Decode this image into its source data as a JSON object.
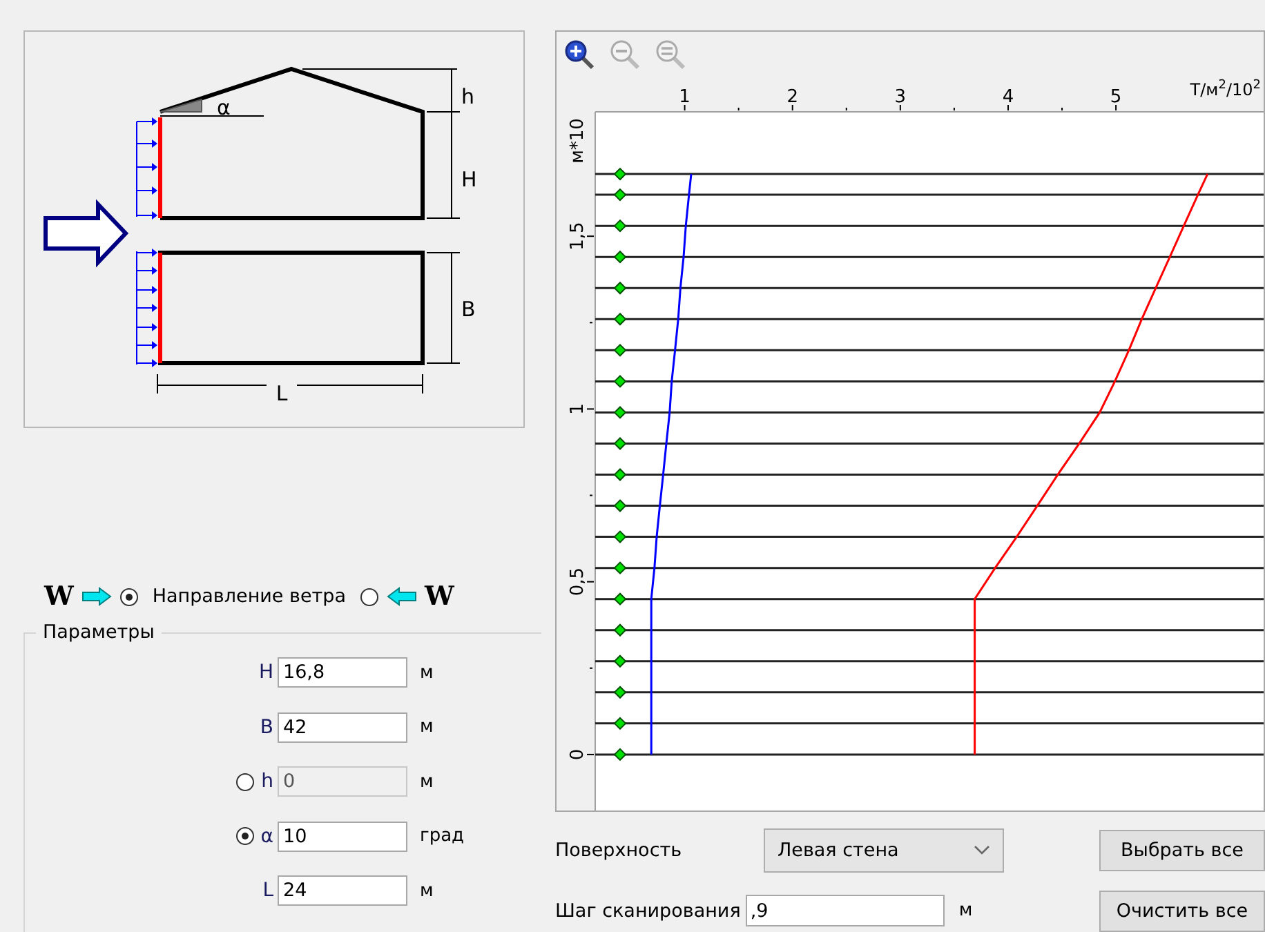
{
  "diagram": {
    "dimension_labels": [
      "h",
      "H",
      "B",
      "L",
      "α"
    ]
  },
  "wind_direction": {
    "label": "Направление ветра",
    "options": [
      {
        "letter": "W",
        "kind": "wind_right",
        "selected": true
      },
      {
        "letter": "W",
        "kind": "wind_left",
        "selected": false
      }
    ]
  },
  "parameters": {
    "title": "Параметры",
    "fields": [
      {
        "label": "H",
        "value": "16,8",
        "unit": "м",
        "kind": "plain",
        "disabled": false
      },
      {
        "label": "B",
        "value": "42",
        "unit": "м",
        "kind": "plain",
        "disabled": false
      },
      {
        "label": "h",
        "value": "0",
        "unit": "м",
        "kind": "radio",
        "selected": false,
        "disabled": true
      },
      {
        "label": "α",
        "value": "10",
        "unit": "град",
        "kind": "radio",
        "selected": true,
        "disabled": false
      },
      {
        "label": "L",
        "value": "24",
        "unit": "м",
        "kind": "plain",
        "disabled": false
      }
    ]
  },
  "chart": {
    "toolbar": [
      {
        "kind": "zoom_in",
        "disabled": false
      },
      {
        "kind": "zoom_out",
        "disabled": true
      },
      {
        "kind": "zoom_reset",
        "disabled": true
      }
    ],
    "chart_data": {
      "type": "line",
      "orientation": "horizontal",
      "xlabel": "Т/м$^{2}$/10$^{2}$",
      "ylabel": "м*10",
      "x": [
        0,
        0.09,
        0.18,
        0.27,
        0.36,
        0.45,
        0.54,
        0.63,
        0.72,
        0.81,
        0.9,
        0.99,
        1.08,
        1.17,
        1.26,
        1.35,
        1.44,
        1.53,
        1.62,
        1.68
      ],
      "series": [
        {
          "color": "#0000ff",
          "values": [
            0.69,
            0.69,
            0.69,
            0.69,
            0.69,
            0.69,
            0.72,
            0.74,
            0.77,
            0.8,
            0.83,
            0.86,
            0.88,
            0.91,
            0.94,
            0.96,
            0.99,
            1.01,
            1.04,
            1.06
          ]
        },
        {
          "color": "#ff0000",
          "values": [
            3.69,
            3.69,
            3.69,
            3.69,
            3.69,
            3.69,
            3.88,
            4.08,
            4.27,
            4.46,
            4.66,
            4.85,
            4.99,
            5.12,
            5.24,
            5.37,
            5.5,
            5.63,
            5.76,
            5.85
          ]
        }
      ],
      "xlim": [
        0.17,
        6.37
      ],
      "ylim": [
        -0.17,
        1.86
      ],
      "xticks": [
        {
          "value": 1,
          "label": "1"
        },
        {
          "value": 2,
          "label": "2"
        },
        {
          "value": 3,
          "label": "3"
        },
        {
          "value": 4,
          "label": "4"
        },
        {
          "value": 5,
          "label": "5"
        }
      ],
      "yticks": [
        {
          "value": 0,
          "label": "0"
        },
        {
          "value": 0.5,
          "label": "0,5"
        },
        {
          "value": 1,
          "label": "1"
        },
        {
          "value": 1.5,
          "label": "1,5"
        }
      ]
    }
  },
  "surface": {
    "label": "Поверхность",
    "value": "Левая стена"
  },
  "scan_step": {
    "label": "Шаг сканирования",
    "value": ",9",
    "unit": "м"
  },
  "buttons": [
    "Выбрать все",
    "Очистить все"
  ]
}
